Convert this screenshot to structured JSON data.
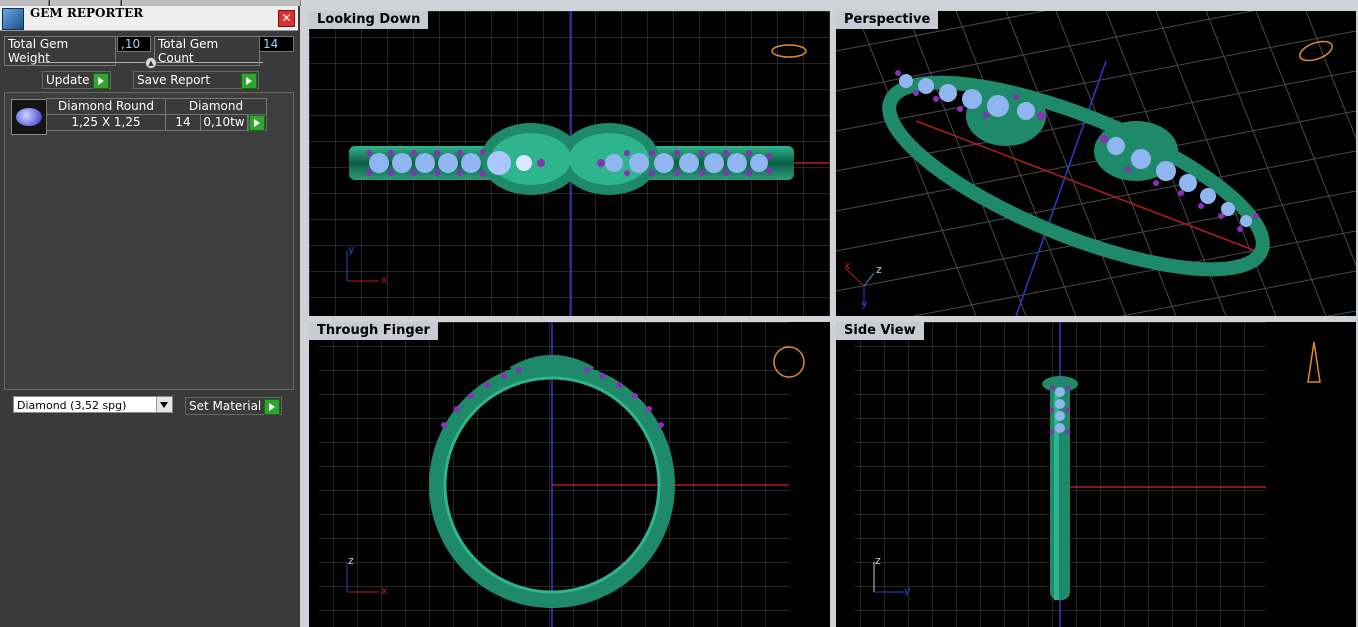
{
  "panel": {
    "title": "GEM REPORTER",
    "total_gem_weight_label": "Total Gem Weight",
    "total_gem_weight_value": ",10",
    "total_gem_count_label": "Total Gem Count",
    "total_gem_count_value": "14",
    "update_label": "Update",
    "save_report_label": "Save Report",
    "gems": [
      {
        "shape": "Diamond Round",
        "size": "1,25 X 1,25",
        "material": "Diamond",
        "count": "14",
        "weight": "0,10tw"
      }
    ],
    "material_select_value": "Diamond     (3,52 spg)",
    "set_material_label": "Set Material"
  },
  "viewports": {
    "top_left": "Looking Down",
    "top_right": "Perspective",
    "bottom_left": "Through Finger",
    "bottom_right": "Side View"
  },
  "axes": {
    "x": "x",
    "y": "y",
    "z": "z"
  },
  "colors": {
    "viewport_bg": "#000000",
    "grid": "#4a4a4a",
    "ring_metal": "#2a9d7a",
    "gem_stone": "#8fb6f0",
    "prong_purple": "#8a2fb8",
    "axis_x": "#b21e1e",
    "axis_y": "#2a3fc8"
  }
}
